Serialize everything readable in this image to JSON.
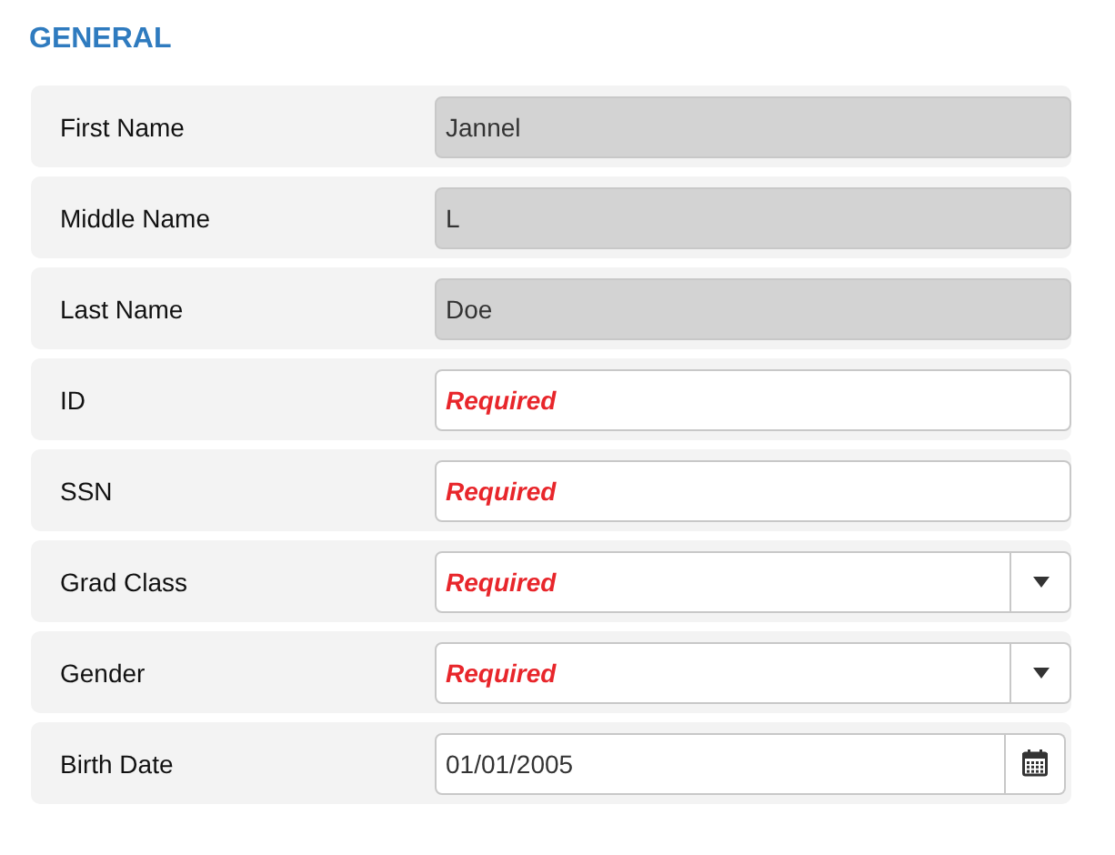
{
  "section": {
    "title": "GENERAL"
  },
  "fields": [
    {
      "label": "First Name",
      "kind": "text",
      "disabled": true,
      "value": "Jannel"
    },
    {
      "label": "Middle Name",
      "kind": "text",
      "disabled": true,
      "value": "L"
    },
    {
      "label": "Last Name",
      "kind": "text",
      "disabled": true,
      "value": "Doe"
    },
    {
      "label": "ID",
      "kind": "text",
      "disabled": false,
      "placeholder": "Required"
    },
    {
      "label": "SSN",
      "kind": "text",
      "disabled": false,
      "placeholder": "Required"
    },
    {
      "label": "Grad Class",
      "kind": "select",
      "disabled": false,
      "placeholder": "Required"
    },
    {
      "label": "Gender",
      "kind": "select",
      "disabled": false,
      "placeholder": "Required"
    },
    {
      "label": "Birth Date",
      "kind": "date",
      "disabled": false,
      "value": "01/01/2005"
    }
  ]
}
